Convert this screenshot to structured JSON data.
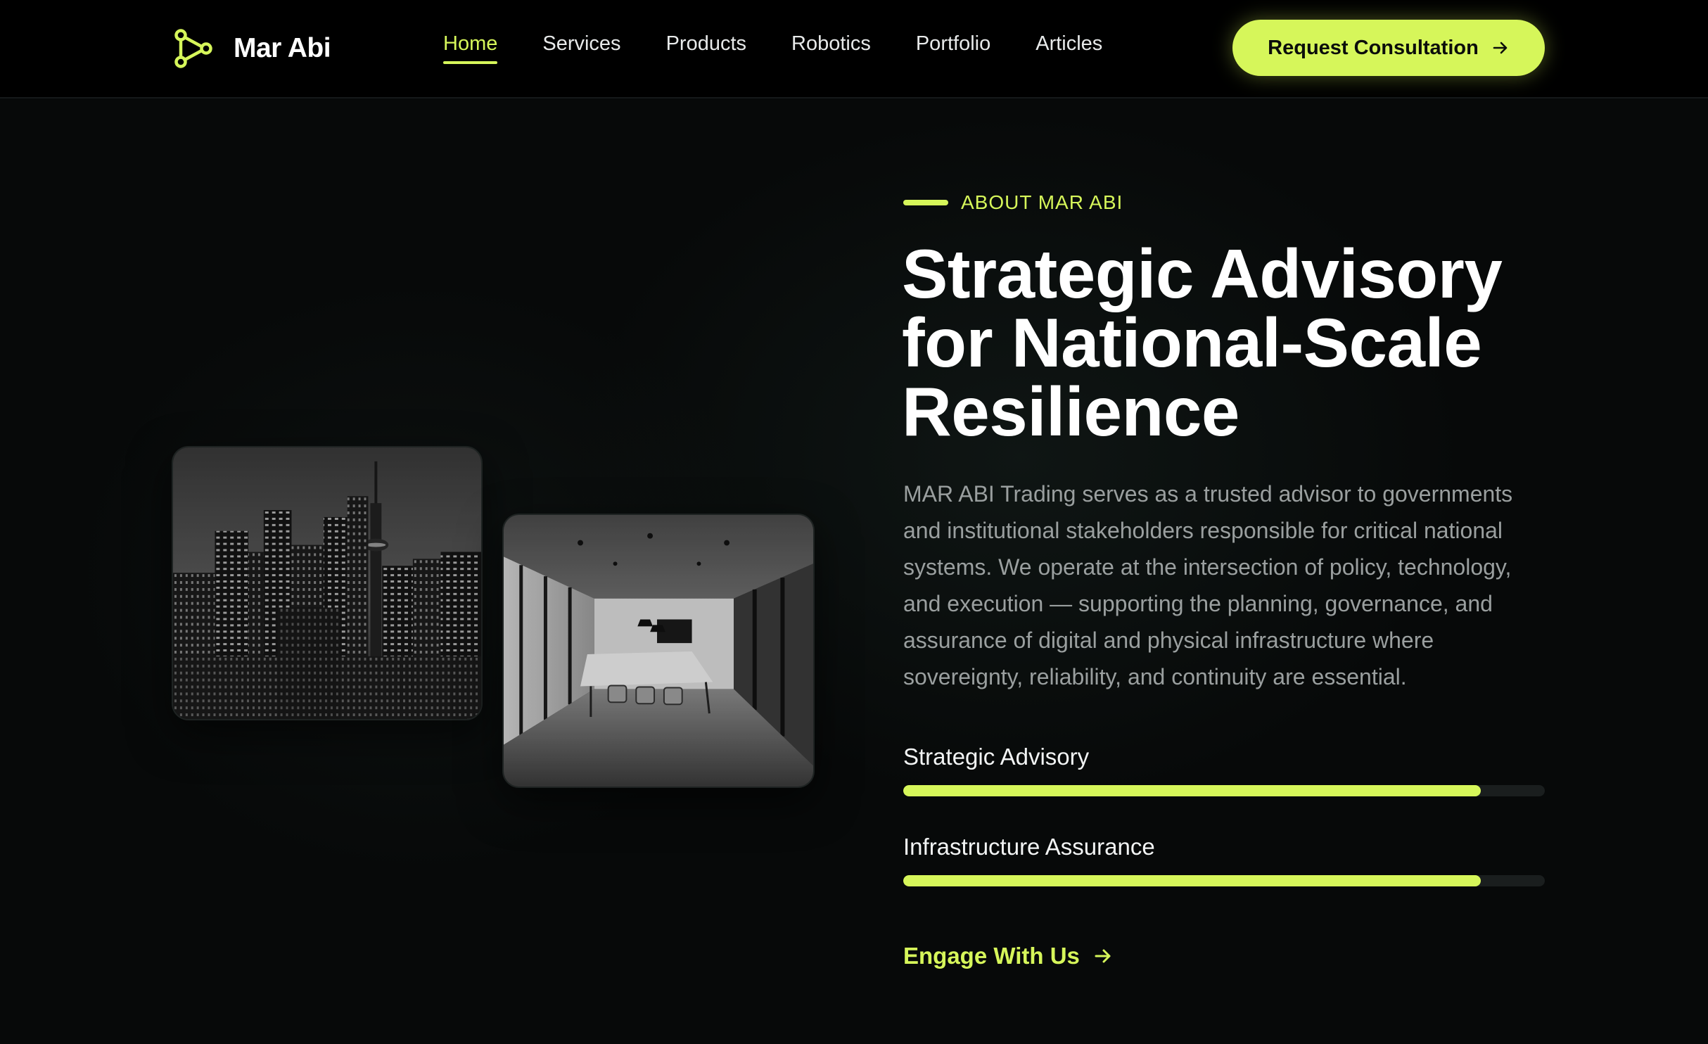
{
  "brand": {
    "name": "Mar Abi",
    "icon": "node-network-icon",
    "accent_color": "#d6f65a"
  },
  "nav": {
    "items": [
      {
        "label": "Home",
        "active": true
      },
      {
        "label": "Services",
        "active": false
      },
      {
        "label": "Products",
        "active": false
      },
      {
        "label": "Robotics",
        "active": false
      },
      {
        "label": "Portfolio",
        "active": false
      },
      {
        "label": "Articles",
        "active": false
      }
    ]
  },
  "header": {
    "cta_label": "Request Consultation",
    "cta_icon": "arrow-right-icon"
  },
  "images": [
    {
      "subject": "city-skyline-photo",
      "tone": "grayscale"
    },
    {
      "subject": "office-meeting-room-photo",
      "tone": "grayscale"
    }
  ],
  "about": {
    "eyebrow": "ABOUT MAR ABI",
    "headline": "Strategic Advisory for National-Scale Resilience",
    "description": "MAR ABI Trading serves as a trusted advisor to governments and institutional stakeholders responsible for critical national systems. We operate at the intersection of policy, technology, and execution — supporting the planning, governance, and assurance of digital and physical infrastructure where sovereignty, reliability, and continuity are essential.",
    "skills": [
      {
        "label": "Strategic Advisory",
        "progress": 0.9
      },
      {
        "label": "Infrastructure Assurance",
        "progress": 0.9
      }
    ],
    "engage_label": "Engage With Us",
    "engage_icon": "arrow-right-icon"
  }
}
